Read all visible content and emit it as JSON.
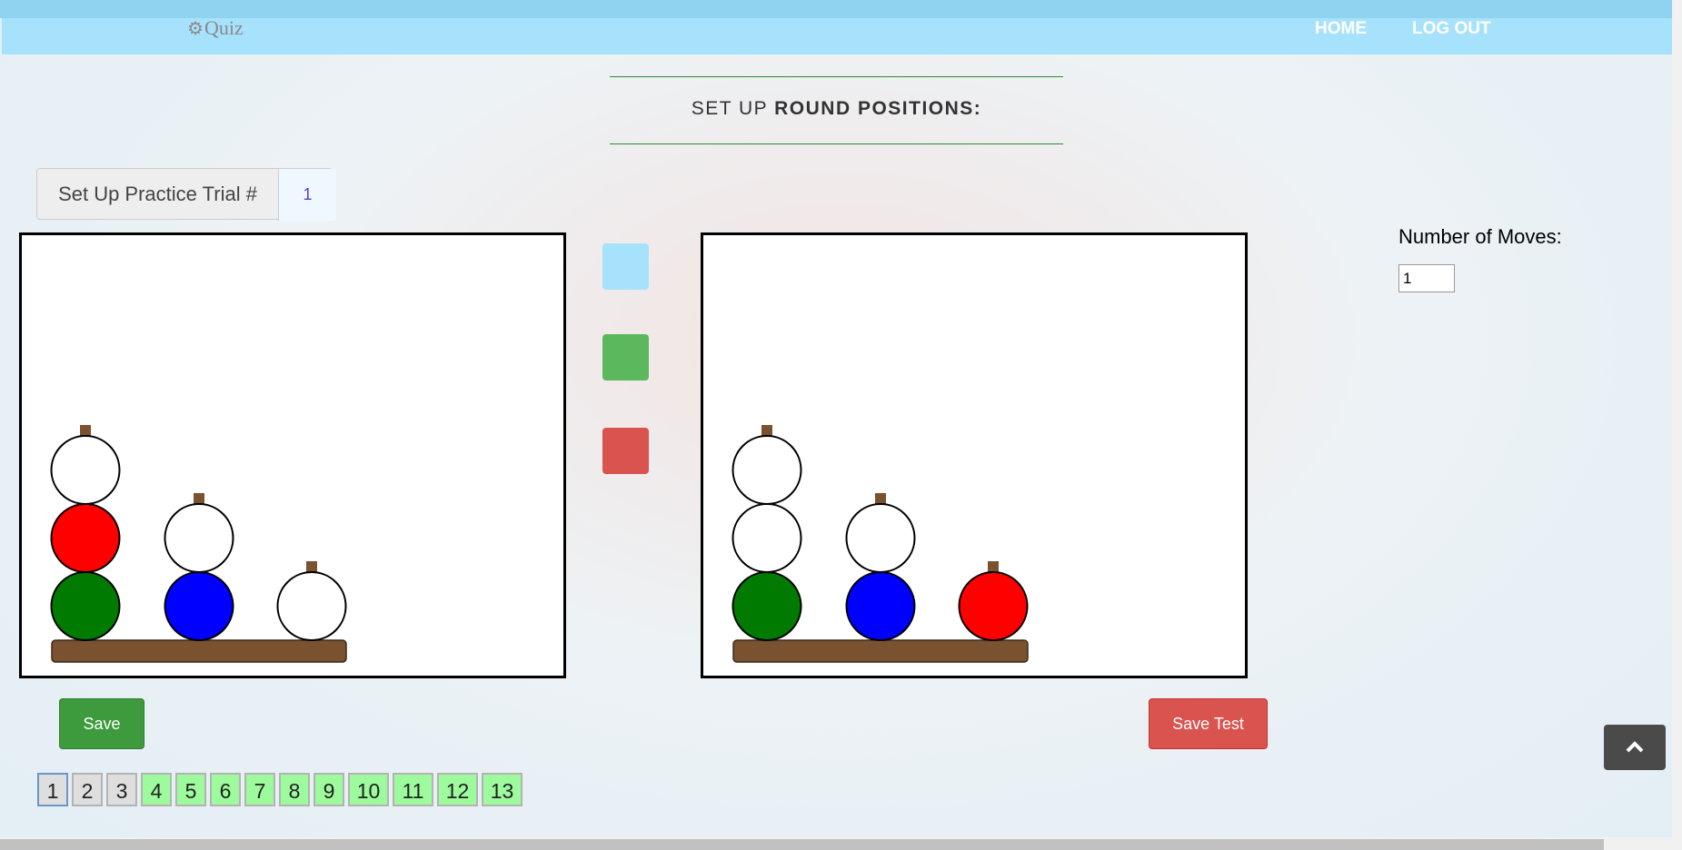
{
  "nav": {
    "logo_icon": "gear-icon",
    "logo_text": "Quiz",
    "links": [
      "HOME",
      "LOG OUT"
    ]
  },
  "header": {
    "title_plain": "SET UP ",
    "title_bold": "ROUND POSITIONS:"
  },
  "trial": {
    "label": "Set Up Practice Trial #",
    "value": "1"
  },
  "moves": {
    "label": "Number of Moves:",
    "value": "1"
  },
  "colors": {
    "white": "#ffffff",
    "red": "#ff0000",
    "green": "#007a00",
    "blue": "#0000ff",
    "peg": "#7a5230",
    "swatch_blue": "#a6e2fc",
    "swatch_green": "#5cb85c",
    "swatch_red": "#d9534f"
  },
  "boards": {
    "start": {
      "pegs": [
        [
          "green",
          "red",
          "white"
        ],
        [
          "blue",
          "white"
        ],
        [
          "white"
        ]
      ]
    },
    "goal": {
      "pegs": [
        [
          "green",
          "white",
          "white"
        ],
        [
          "blue",
          "white"
        ],
        [
          "red"
        ]
      ]
    }
  },
  "palette": [
    "swatch_blue",
    "swatch_green",
    "swatch_red"
  ],
  "buttons": {
    "save": "Save",
    "save_test": "Save Test",
    "scroll_top_icon": "chevron-up-icon"
  },
  "pages": [
    {
      "label": "1",
      "state": "gray",
      "active": true
    },
    {
      "label": "2",
      "state": "gray",
      "active": false
    },
    {
      "label": "3",
      "state": "gray",
      "active": false
    },
    {
      "label": "4",
      "state": "green",
      "active": false
    },
    {
      "label": "5",
      "state": "green",
      "active": false
    },
    {
      "label": "6",
      "state": "green",
      "active": false
    },
    {
      "label": "7",
      "state": "green",
      "active": false
    },
    {
      "label": "8",
      "state": "green",
      "active": false
    },
    {
      "label": "9",
      "state": "green",
      "active": false
    },
    {
      "label": "10",
      "state": "green",
      "active": false
    },
    {
      "label": "11",
      "state": "green",
      "active": false
    },
    {
      "label": "12",
      "state": "green",
      "active": false
    },
    {
      "label": "13",
      "state": "green",
      "active": false
    }
  ]
}
